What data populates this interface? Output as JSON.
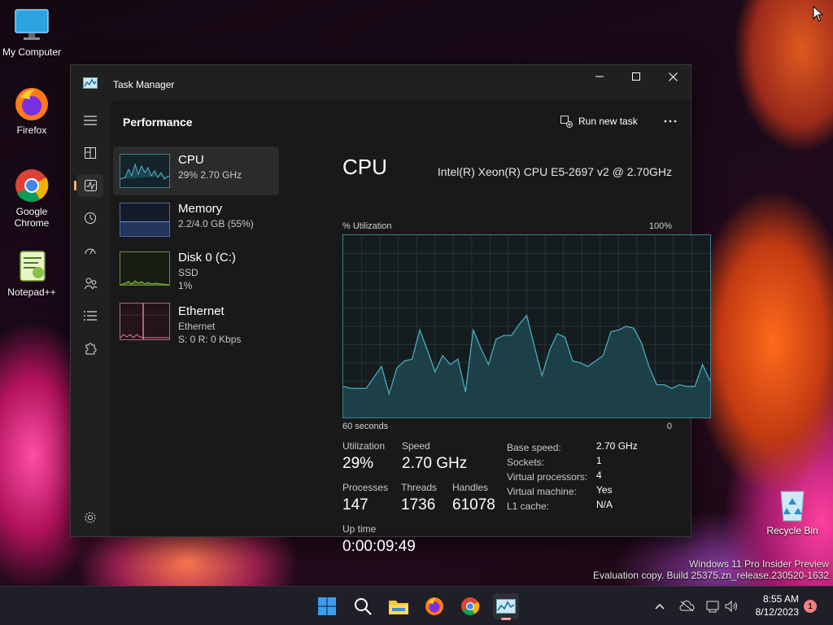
{
  "desktop": {
    "icons": [
      {
        "label": "My Computer"
      },
      {
        "label": "Firefox"
      },
      {
        "label": "Google Chrome"
      },
      {
        "label": "Notepad++"
      },
      {
        "label": "Recycle Bin"
      }
    ],
    "watermark_line1": "Windows 11 Pro Insider Preview",
    "watermark_line2": "Evaluation copy. Build 25375.zn_release.230520-1632"
  },
  "window": {
    "title": "Task Manager",
    "section_title": "Performance",
    "run_new_task_label": "Run new task",
    "more_label": "···"
  },
  "sidebar": {
    "items": [
      {
        "name": "CPU",
        "line2": "29% 2.70 GHz",
        "line3": ""
      },
      {
        "name": "Memory",
        "line2": "2.2/4.0 GB (55%)",
        "line3": ""
      },
      {
        "name": "Disk 0 (C:)",
        "line2": "SSD",
        "line3": "1%"
      },
      {
        "name": "Ethernet",
        "line2": "Ethernet",
        "line3": "S: 0 R: 0 Kbps"
      }
    ]
  },
  "cpu": {
    "title": "CPU",
    "model": "Intel(R) Xeon(R) CPU E5-2697 v2 @ 2.70GHz",
    "graph_label_left": "% Utilization",
    "graph_label_right": "100%",
    "graph_bottom_left": "60 seconds",
    "graph_bottom_right": "0",
    "history": [
      17,
      16,
      16,
      16,
      22,
      28,
      13,
      27,
      31,
      32,
      48,
      37,
      25,
      34,
      29,
      32,
      14,
      48,
      38,
      29,
      43,
      45,
      45,
      51,
      56,
      39,
      23,
      37,
      46,
      44,
      31,
      30,
      28,
      31,
      34,
      47,
      48,
      50,
      49,
      41,
      28,
      18,
      18,
      16,
      18,
      17,
      17,
      29,
      20
    ],
    "stats": {
      "utilization_label": "Utilization",
      "utilization": "29%",
      "speed_label": "Speed",
      "speed": "2.70 GHz",
      "processes_label": "Processes",
      "processes": "147",
      "threads_label": "Threads",
      "threads": "1736",
      "handles_label": "Handles",
      "handles": "61078",
      "uptime_label": "Up time",
      "uptime": "0:00:09:49"
    },
    "specs": [
      {
        "label": "Base speed:",
        "value": "2.70 GHz"
      },
      {
        "label": "Sockets:",
        "value": "1"
      },
      {
        "label": "Virtual processors:",
        "value": "4"
      },
      {
        "label": "Virtual machine:",
        "value": "Yes"
      },
      {
        "label": "L1 cache:",
        "value": "N/A"
      }
    ]
  },
  "taskbar": {
    "time": "8:55 AM",
    "date": "8/12/2023",
    "notification_count": "1"
  },
  "colors": {
    "graph_line": "#4fb3c8",
    "graph_fill": "#1e4650",
    "accent": "#f2b27a"
  }
}
